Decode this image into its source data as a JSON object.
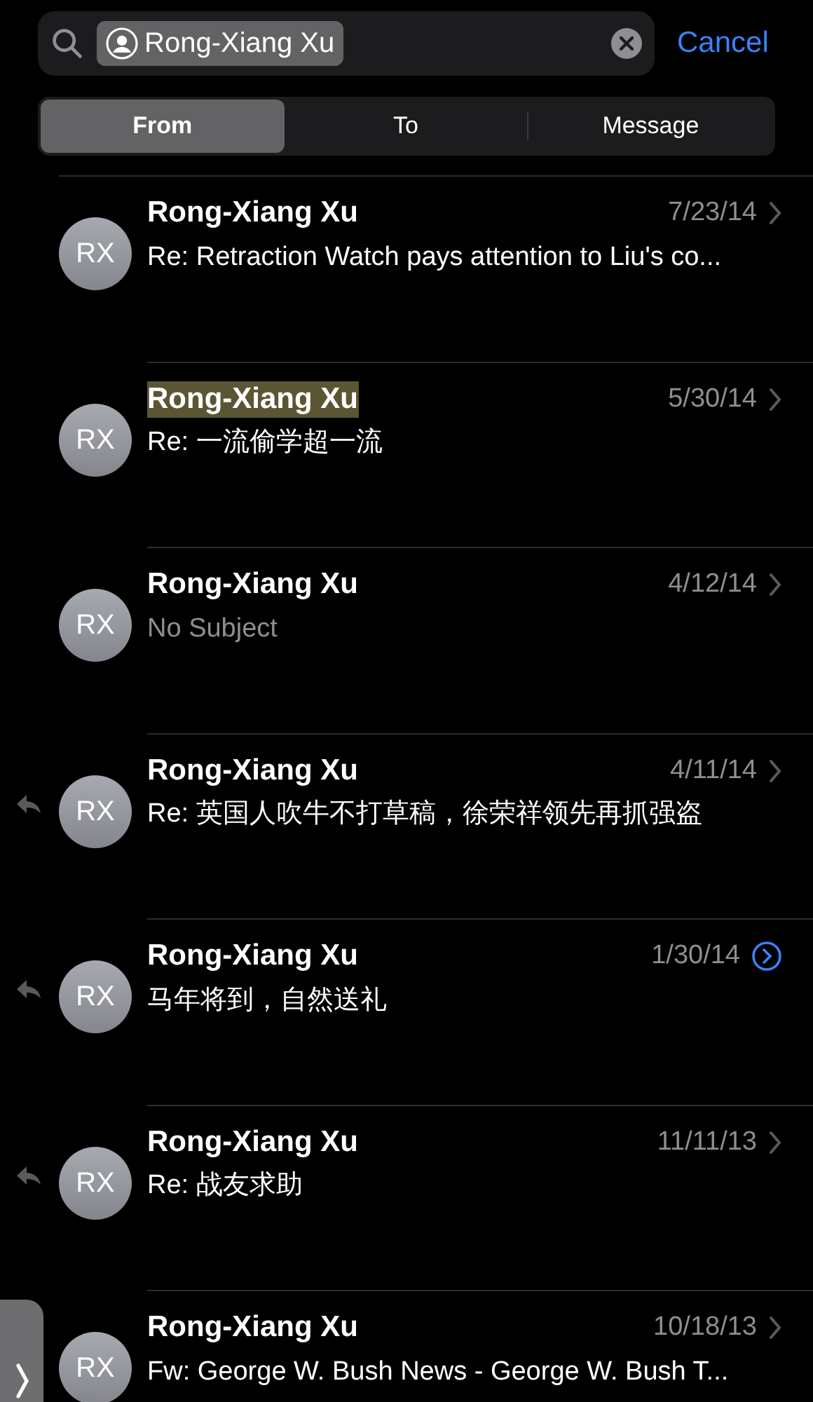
{
  "search": {
    "token": "Rong-Xiang Xu",
    "cancel": "Cancel"
  },
  "scopes": [
    {
      "label": "From",
      "selected": true
    },
    {
      "label": "To",
      "selected": false
    },
    {
      "label": "Message",
      "selected": false
    }
  ],
  "messages": [
    {
      "initials": "RX",
      "sender": "Rong-Xiang Xu",
      "date": "7/23/14",
      "subject": "Re: Retraction Watch pays attention to Liu's co...",
      "highlighted": false,
      "replied": false,
      "no_subject": false,
      "circled_chevron": false
    },
    {
      "initials": "RX",
      "sender": "Rong-Xiang Xu",
      "date": "5/30/14",
      "subject": "Re: 一流偷学超一流",
      "highlighted": true,
      "replied": false,
      "no_subject": false,
      "circled_chevron": false
    },
    {
      "initials": "RX",
      "sender": "Rong-Xiang Xu",
      "date": "4/12/14",
      "subject": "No Subject",
      "highlighted": false,
      "replied": false,
      "no_subject": true,
      "circled_chevron": false
    },
    {
      "initials": "RX",
      "sender": "Rong-Xiang Xu",
      "date": "4/11/14",
      "subject": "Re: 英国人吹牛不打草稿，徐荣祥领先再抓强盗",
      "highlighted": false,
      "replied": true,
      "no_subject": false,
      "circled_chevron": false
    },
    {
      "initials": "RX",
      "sender": "Rong-Xiang Xu",
      "date": "1/30/14",
      "subject": "马年将到，自然送礼",
      "highlighted": false,
      "replied": true,
      "no_subject": false,
      "circled_chevron": true
    },
    {
      "initials": "RX",
      "sender": "Rong-Xiang Xu",
      "date": "11/11/13",
      "subject": "Re: 战友求助",
      "highlighted": false,
      "replied": true,
      "no_subject": false,
      "circled_chevron": false
    },
    {
      "initials": "RX",
      "sender": "Rong-Xiang Xu",
      "date": "10/18/13",
      "subject": "Fw: George W. Bush News - George W. Bush T...",
      "highlighted": false,
      "replied": false,
      "no_subject": false,
      "circled_chevron": false
    }
  ]
}
